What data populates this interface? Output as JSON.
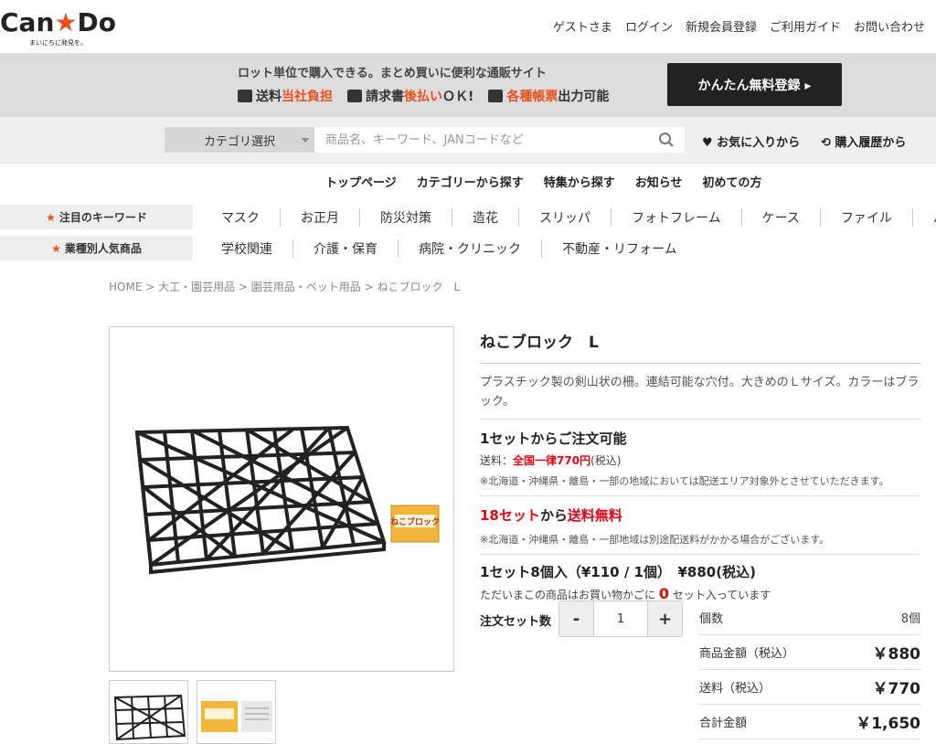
{
  "logo": {
    "word_pre": "Can",
    "star": "★",
    "word_post": "Do",
    "tagline": "まいにちに発見を。"
  },
  "topnav": [
    "ゲストさま",
    "ログイン",
    "新規会員登録",
    "ご利用ガイド",
    "お問い合わせ"
  ],
  "banner": {
    "line1": "ロット単位で購入できる。まとめ買いに便利な通販サイト",
    "features": [
      {
        "icon": "truck-icon",
        "pre": "送料",
        "hl": "当社負担",
        "post": ""
      },
      {
        "icon": "invoice-icon",
        "pre": "請求書",
        "hl": "後払い",
        "post": "ＯＫ!"
      },
      {
        "icon": "document-icon",
        "pre": "",
        "hl": "各種帳票",
        "post": "出力可能"
      }
    ],
    "register_label": "かんたん無料登録 ▸"
  },
  "search": {
    "category_label": "カテゴリ選択",
    "placeholder": "商品名、キーワード、JANコードなど",
    "favorites_label": "♥ お気に入りから",
    "history_label": "購入履歴から"
  },
  "mainnav": [
    "トップページ",
    "カテゴリーから探す",
    "特集から探す",
    "お知らせ",
    "初めての方"
  ],
  "keywords": {
    "label": "注目のキーワード",
    "items": [
      "マスク",
      "お正月",
      "防災対策",
      "造花",
      "スリッパ",
      "フォトフレーム",
      "ケース",
      "ファイル",
      "バ"
    ]
  },
  "industries": {
    "label": "業種別人気商品",
    "items": [
      "学校関連",
      "介護・保育",
      "病院・クリニック",
      "不動産・リフォーム"
    ]
  },
  "breadcrumb": "HOME  > 大工・園芸用品  > 園芸用品・ペット用品  > ねこブロック　L",
  "product": {
    "title": "ねこブロック　L",
    "description": "プラスチック製の剣山状の柵。連結可能な穴付。大きめのＬサイズ。カラーはブラック。",
    "min_order": "1セットからご注文可能",
    "shipping_label": "送料：",
    "shipping_value": "全国一律770円",
    "shipping_tax": "(税込)",
    "shipping_note": "※北海道・沖縄県・離島・一部の地域においては配送エリア対象外とさせていただきます。",
    "free_sets": "18セット",
    "free_mid": "から",
    "free_label": "送料無料",
    "free_note": "※北海道・沖縄県・離島・一部地域は別途配送料がかかる場合がございます。",
    "set_info": "1セット8個入（¥110 / 1個）　¥880(税込)",
    "cart_pre": "ただいまこの商品はお買い物かごに",
    "cart_count": "0",
    "cart_post": "セット入っています",
    "package_text": "ねこブロック"
  },
  "order": {
    "qty_label": "注文セット数",
    "minus": "-",
    "qty": "1",
    "plus": "+"
  },
  "price_table": [
    {
      "label": "個数",
      "value": "8個"
    },
    {
      "label": "商品金額（税込）",
      "value": "￥880"
    },
    {
      "label": "送料（税込）",
      "value": "￥770"
    },
    {
      "label": "合計金額",
      "value": "￥1,650"
    }
  ]
}
